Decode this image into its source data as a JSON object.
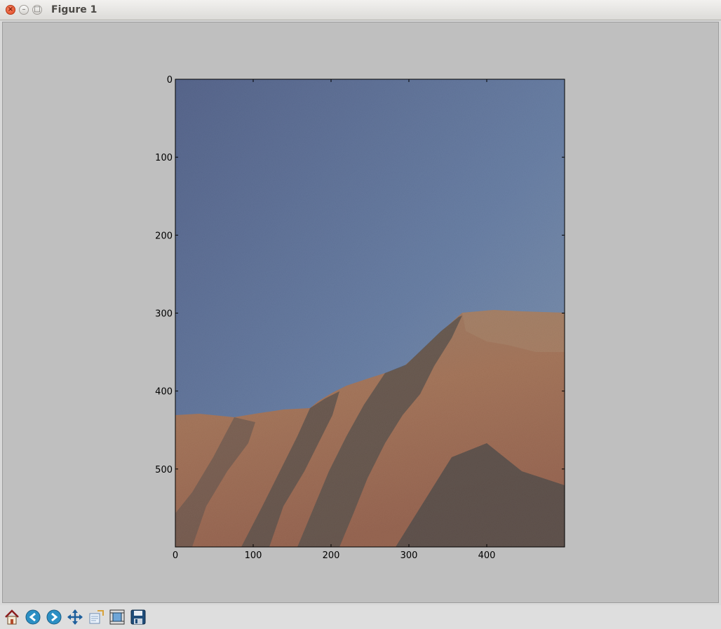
{
  "window": {
    "title": "Figure 1",
    "close_glyph": "×",
    "minimize_glyph": "–",
    "maximize_glyph": "□"
  },
  "toolbar": {
    "buttons": [
      {
        "name": "home-button",
        "icon": "home-icon"
      },
      {
        "name": "back-button",
        "icon": "arrow-left-icon"
      },
      {
        "name": "forward-button",
        "icon": "arrow-right-icon"
      },
      {
        "name": "pan-button",
        "icon": "move-arrows-icon"
      },
      {
        "name": "zoom-button",
        "icon": "zoom-rect-icon"
      },
      {
        "name": "configure-subplots-button",
        "icon": "subplots-icon"
      },
      {
        "name": "save-button",
        "icon": "floppy-disk-icon"
      }
    ]
  },
  "chart_data": {
    "type": "image",
    "image_description": "desert mesa at sunset under a blue sky",
    "xlim": [
      0,
      500
    ],
    "ylim": [
      600,
      0
    ],
    "xticks": [
      0,
      100,
      200,
      300,
      400
    ],
    "yticks": [
      0,
      100,
      200,
      300,
      400,
      500
    ],
    "xtick_labels": [
      "0",
      "100",
      "200",
      "300",
      "400"
    ],
    "ytick_labels": [
      "0",
      "100",
      "200",
      "300",
      "400",
      "500"
    ],
    "colors": {
      "sky_top": "#2f55a8",
      "sky_bottom": "#79a8e6",
      "rock_lit": "#d2743c",
      "rock_shadow": "#2b1a12",
      "canvas_bg": "#bfbfbf"
    }
  }
}
